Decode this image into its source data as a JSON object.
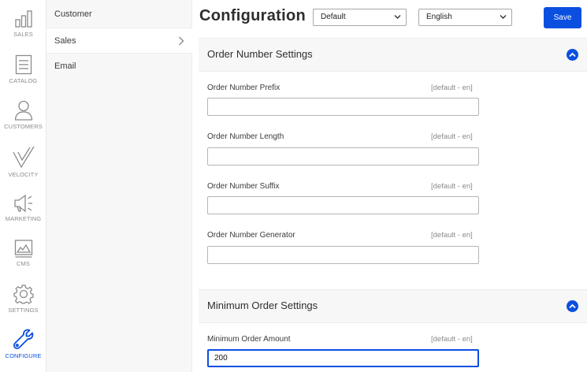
{
  "nav": {
    "items": [
      {
        "label": "SALES",
        "icon": "bar-chart-icon"
      },
      {
        "label": "CATALOG",
        "icon": "catalog-icon"
      },
      {
        "label": "CUSTOMERS",
        "icon": "user-icon"
      },
      {
        "label": "VELOCITY",
        "icon": "velocity-icon"
      },
      {
        "label": "MARKETING",
        "icon": "megaphone-icon"
      },
      {
        "label": "CMS",
        "icon": "image-icon"
      },
      {
        "label": "SETTINGS",
        "icon": "gear-icon"
      },
      {
        "label": "CONFIGURE",
        "icon": "wrench-icon"
      }
    ],
    "active": "CONFIGURE"
  },
  "submenu": {
    "items": [
      {
        "label": "Customer"
      },
      {
        "label": "Sales"
      },
      {
        "label": "Email"
      }
    ],
    "active": "Sales"
  },
  "header": {
    "title": "Configuration",
    "channel_select": "Default",
    "locale_select": "English",
    "save_label": "Save"
  },
  "sections": [
    {
      "title": "Order Number Settings",
      "fields": [
        {
          "label": "Order Number Prefix",
          "scope": "[default - en]",
          "value": ""
        },
        {
          "label": "Order Number Length",
          "scope": "[default - en]",
          "value": ""
        },
        {
          "label": "Order Number Suffix",
          "scope": "[default - en]",
          "value": ""
        },
        {
          "label": "Order Number Generator",
          "scope": "[default - en]",
          "value": ""
        }
      ]
    },
    {
      "title": "Minimum Order Settings",
      "fields": [
        {
          "label": "Minimum Order Amount",
          "scope": "[default - en]",
          "value": "200"
        }
      ]
    }
  ],
  "colors": {
    "accent": "#0b4fe0",
    "rail_icon": "#8a8a8a",
    "panel_bg": "#f7f7f7"
  }
}
